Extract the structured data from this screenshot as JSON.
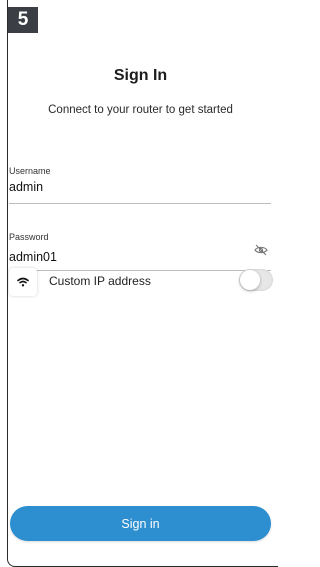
{
  "step_badge": "5",
  "header": {
    "title": "Sign In",
    "subtitle": "Connect to your router to get started"
  },
  "form": {
    "username": {
      "label": "Username",
      "value": "admin"
    },
    "password": {
      "label": "Password",
      "value": "admin01",
      "visibility_icon": "eye-off-icon"
    },
    "custom_ip": {
      "label": "Custom IP address",
      "icon": "wifi-icon",
      "enabled": false
    }
  },
  "actions": {
    "sign_in_label": "Sign in"
  },
  "colors": {
    "accent": "#2e8fd0",
    "badge_bg": "#3b3f45"
  }
}
